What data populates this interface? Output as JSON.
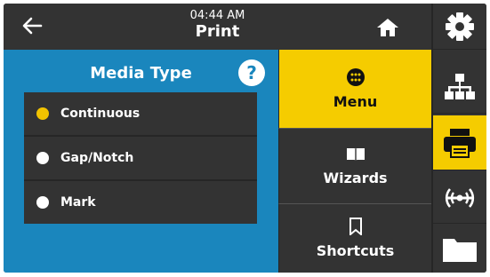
{
  "header": {
    "time": "04:44 AM",
    "title": "Print"
  },
  "media_panel": {
    "title": "Media Type",
    "help_label": "?",
    "options": [
      {
        "label": "Continuous",
        "selected": true
      },
      {
        "label": "Gap/Notch",
        "selected": false
      },
      {
        "label": "Mark",
        "selected": false
      }
    ]
  },
  "menu_buttons": [
    {
      "label": "Menu",
      "icon": "dots-grid-icon",
      "active": true
    },
    {
      "label": "Wizards",
      "icon": "book-icon",
      "active": false
    },
    {
      "label": "Shortcuts",
      "icon": "bookmark-icon",
      "active": false
    }
  ],
  "sidebar": {
    "items": [
      {
        "icon": "gear-icon",
        "active": false
      },
      {
        "icon": "network-icon",
        "active": false
      },
      {
        "icon": "printer-icon",
        "active": true
      },
      {
        "icon": "rfid-icon",
        "active": false
      },
      {
        "icon": "folder-icon",
        "active": false
      }
    ]
  },
  "colors": {
    "accent_yellow": "#f5cc00",
    "panel_blue": "#1a86bd",
    "dark": "#333333"
  }
}
